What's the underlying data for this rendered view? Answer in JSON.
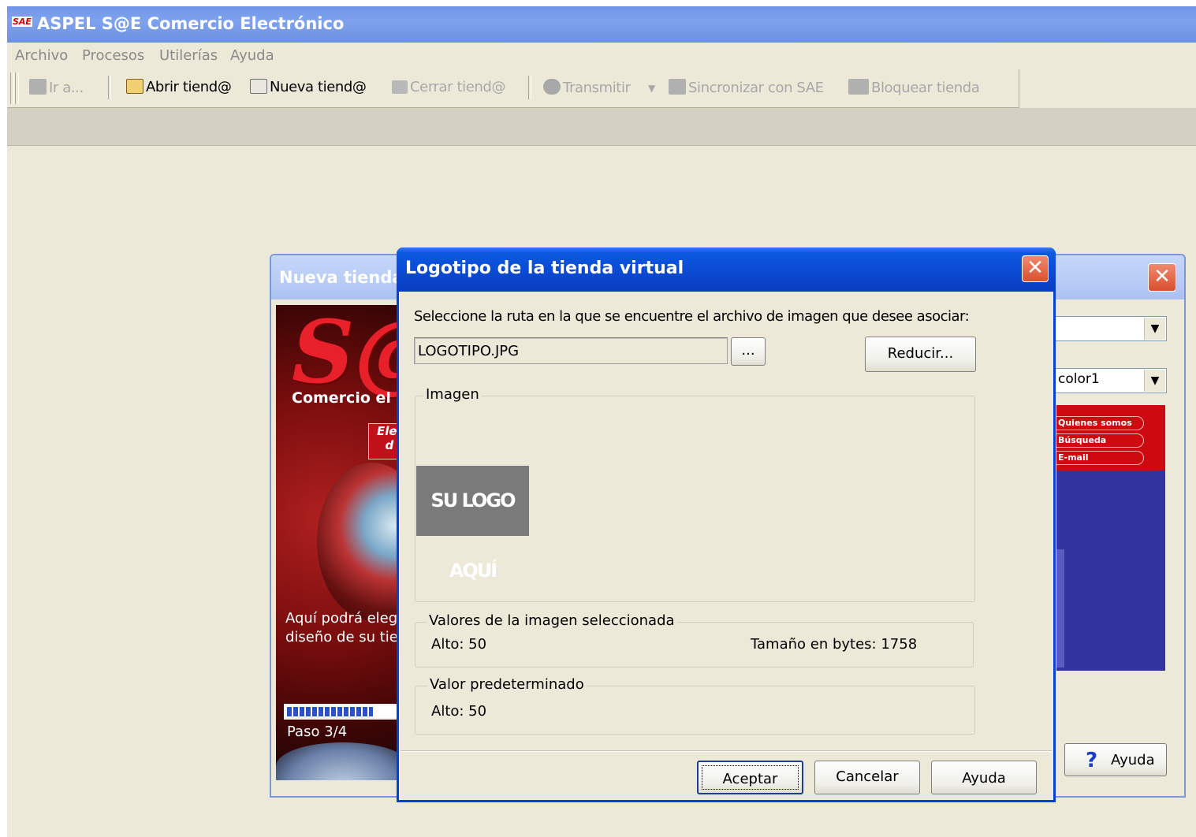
{
  "app": {
    "title": "ASPEL S@E Comercio Electrónico",
    "logo_text": "SAE",
    "menu": [
      "Archivo",
      "Procesos",
      "Utilerías",
      "Ayuda"
    ],
    "toolbar": {
      "ir": "Ir a...",
      "abrir": "Abrir tiend@",
      "nueva": "Nueva tiend@",
      "cerrar": "Cerrar tiend@",
      "transmitir": "Transmitir",
      "sincronizar": "Sincronizar con SAE",
      "bloquear": "Bloquear tienda"
    }
  },
  "wizard": {
    "title": "Nueva tienda",
    "brand_letters": "S@",
    "brand_subtitle": "Comercio el",
    "red_box_text": "Ele\nd",
    "description_line1": "Aquí podrá elegi",
    "description_line2": "diseño de su tier",
    "step": "Paso 3/4",
    "progress": 0.75,
    "combo2_value": "color1",
    "preview_links": [
      "Quienes somos",
      "Búsqueda",
      "E-mail"
    ],
    "help_button": "Ayuda"
  },
  "dialog": {
    "title": "Logotipo de la tienda virtual",
    "instruction": "Seleccione la ruta en la que se encuentre el archivo de imagen que desee asociar:",
    "file_value": "LOGOTIPO.JPG",
    "browse_label": "...",
    "reduce_label": "Reducir...",
    "image_group": "Imagen",
    "logo_placeholder": "SU LOGO AQUÍ",
    "values_group": "Valores de la imagen seleccionada",
    "alto_selected": "Alto: 50",
    "size_bytes": "Tamaño en bytes: 1758",
    "default_group": "Valor predeterminado",
    "alto_default": "Alto: 50",
    "accept": "Aceptar",
    "cancel": "Cancelar",
    "help": "Ayuda"
  },
  "colors": {
    "xp_blue_title": "#0a48d0",
    "window_bg": "#ece9d8",
    "close_red": "#d9502f"
  }
}
